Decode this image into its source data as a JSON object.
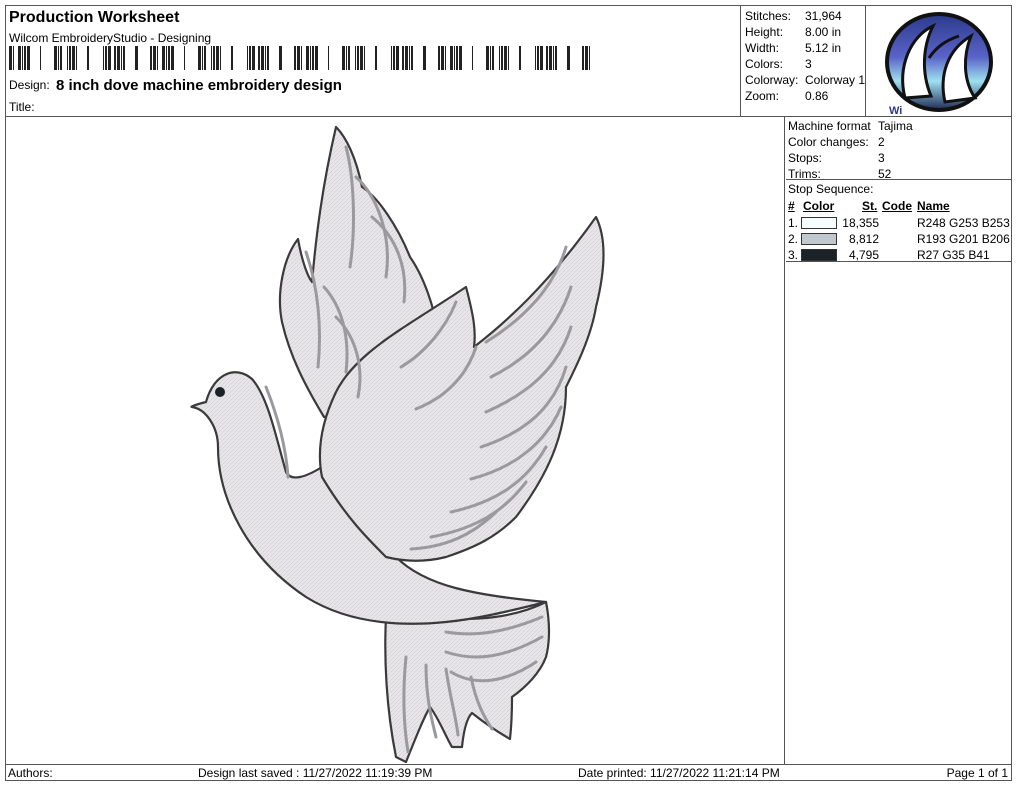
{
  "header": {
    "title": "Production Worksheet",
    "subtitle": "Wilcom EmbroideryStudio - Designing",
    "design_label": "Design:",
    "design_name": "8 inch dove machine embroidery design",
    "title_label": "Title:"
  },
  "stats": [
    {
      "label": "Stitches:",
      "value": "31,964"
    },
    {
      "label": "Height:",
      "value": "8.00 in"
    },
    {
      "label": "Width:",
      "value": "5.12 in"
    },
    {
      "label": "Colors:",
      "value": "3"
    },
    {
      "label": "Colorway:",
      "value": "Colorway 1"
    },
    {
      "label": "Zoom:",
      "value": "0.86"
    }
  ],
  "machine": [
    {
      "label": "Machine format",
      "value": "Tajima"
    },
    {
      "label": "Color changes:",
      "value": "2"
    },
    {
      "label": "Stops:",
      "value": "3"
    },
    {
      "label": "Trims:",
      "value": "52"
    }
  ],
  "stop_sequence": {
    "title": "Stop Sequence:",
    "headers": {
      "num": "#",
      "color": "Color",
      "st": "St.",
      "code": "Code",
      "name": "Name"
    },
    "rows": [
      {
        "num": "1.",
        "color": "#F8FDFD",
        "st": "18,355",
        "code": "",
        "name": "R248 G253 B253"
      },
      {
        "num": "2.",
        "color": "#C1C9CE",
        "st": "8,812",
        "code": "",
        "name": "R193 G201 B206"
      },
      {
        "num": "3.",
        "color": "#1B2329",
        "st": "4,795",
        "code": "",
        "name": "R27 G35 B41"
      }
    ]
  },
  "footer": {
    "authors": "Authors:",
    "saved": "Design last saved : 11/27/2022 11:19:39 PM",
    "printed": "Date printed: 11/27/2022 11:21:14 PM",
    "page": "Page 1 of 1"
  }
}
